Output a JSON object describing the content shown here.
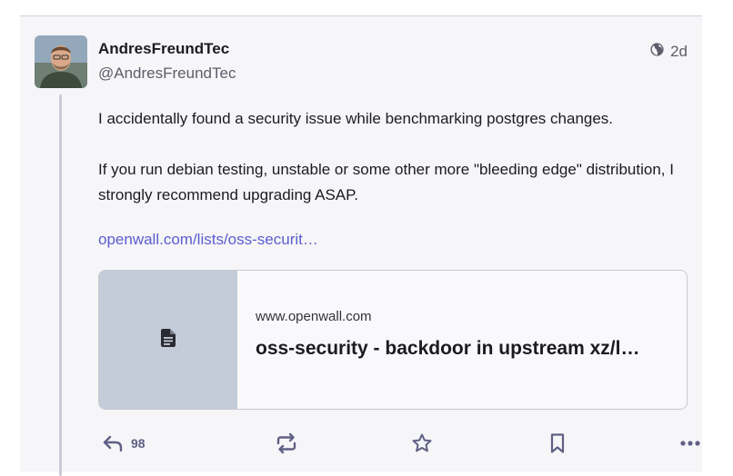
{
  "post": {
    "author": {
      "display_name": "AndresFreundTec",
      "handle": "@AndresFreundTec"
    },
    "visibility_icon": "globe-icon",
    "timestamp": "2d",
    "paragraphs": [
      "I accidentally found a security issue while benchmarking postgres changes.",
      "If you run debian testing, unstable or some other more \"bleeding edge\" distribution, I strongly recommend upgrading ASAP."
    ],
    "link_text": "openwall.com/lists/oss-securit…",
    "preview_card": {
      "thumbnail_icon": "document-icon",
      "domain": "www.openwall.com",
      "title": "oss-security - backdoor in upstream xz/l…"
    },
    "actions": {
      "reply_icon": "reply-icon",
      "reply_count": "98",
      "boost_icon": "boost-icon",
      "favourite_icon": "star-icon",
      "bookmark_icon": "bookmark-icon",
      "more_icon": "more-icon"
    }
  },
  "colors": {
    "link": "#5a5ed0",
    "action_icon": "#606085",
    "card_thumb": "#c3ccd8",
    "background": "#f6f5f7"
  }
}
